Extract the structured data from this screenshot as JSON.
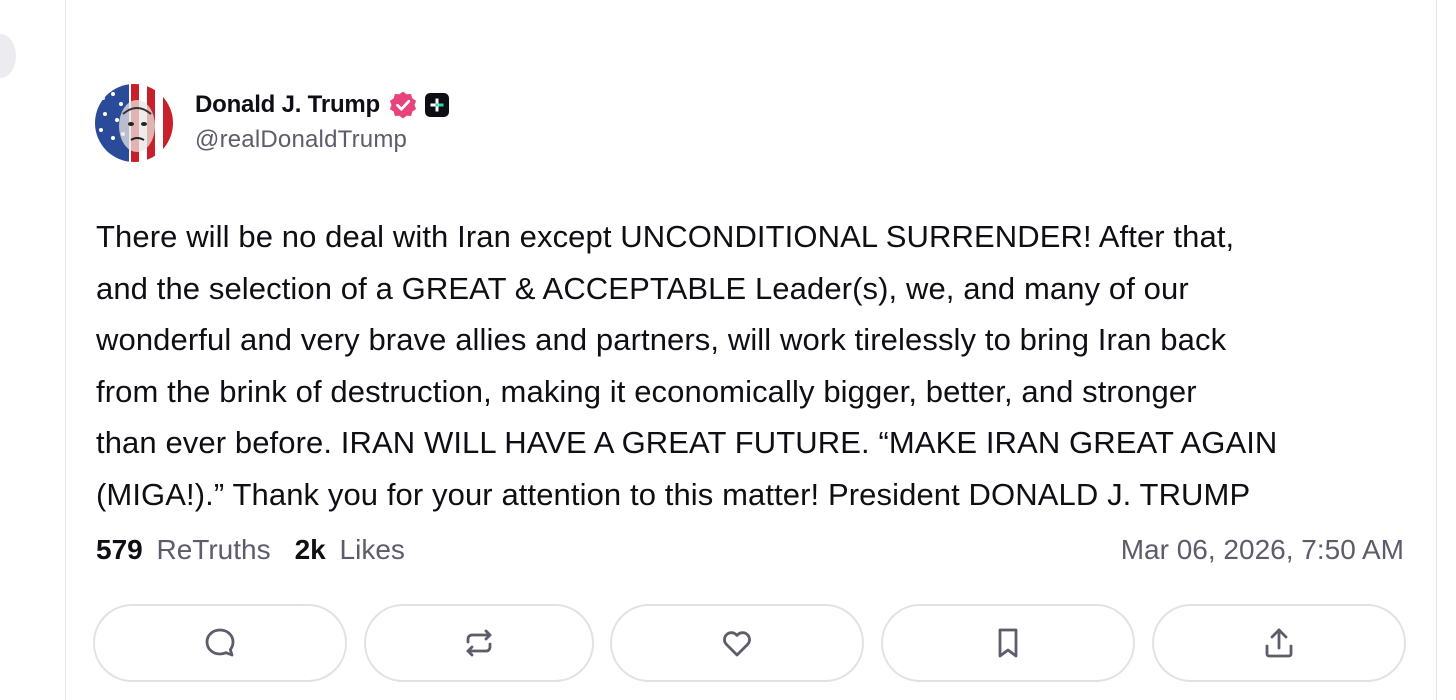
{
  "post": {
    "author": {
      "display_name": "Donald J. Trump",
      "handle": "@realDonaldTrump",
      "avatar_icon": "flag-portrait-avatar",
      "verified_icon": "verified-badge-icon",
      "plus_icon": "truth-plus-badge-icon"
    },
    "text": "There will be no deal with Iran except UNCONDITIONAL SURRENDER! After that,\nand the selection of a GREAT & ACCEPTABLE Leader(s), we, and many of our\nwonderful and very brave allies and partners, will work tirelessly to bring Iran back\nfrom the brink of destruction, making it economically bigger, better, and stronger\nthan ever before. IRAN WILL HAVE A GREAT FUTURE. “MAKE IRAN GREAT AGAIN\n(MIGA!).” Thank you for your attention to this matter! President DONALD J. TRUMP",
    "stats": {
      "retruths_count": "579",
      "retruths_label": "ReTruths",
      "likes_count": "2k",
      "likes_label": "Likes"
    },
    "timestamp": "Mar 06, 2026, 7:50 AM",
    "actions": [
      {
        "name": "reply",
        "icon": "comment-icon"
      },
      {
        "name": "retruth",
        "icon": "repost-icon"
      },
      {
        "name": "like",
        "icon": "heart-icon"
      },
      {
        "name": "bookmark",
        "icon": "bookmark-icon"
      },
      {
        "name": "share",
        "icon": "share-icon"
      }
    ]
  },
  "colors": {
    "text_primary": "#0f0e15",
    "text_secondary": "#5e5b6b",
    "verified": "#e8437b",
    "border": "#e2e1e8"
  }
}
